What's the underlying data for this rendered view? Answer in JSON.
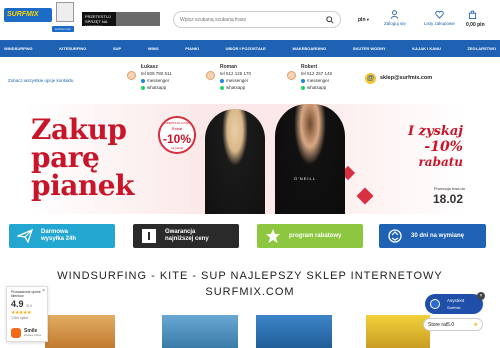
{
  "header": {
    "logo_text": "SURFMIX",
    "logo_sub": "surfmix.com",
    "promo_text": "PRZETESTUJ SPRZĘT NA MIEJSCU",
    "search_placeholder": "Wpisz szukaną szukaną frazę",
    "lang": "pln",
    "account_label": "Zaloguj się",
    "wishlist_label": "Listy zakupowe",
    "cart_total": "0,00 pln"
  },
  "nav": {
    "items": [
      "Windsurfing",
      "Kitesurfing",
      "SUP",
      "Wing",
      "Pianki",
      "Ubiór i pozostałe",
      "Wakeboarding",
      "Skuter wodny",
      "Kajak i kanu",
      "Żeglarstwo"
    ]
  },
  "contact": {
    "link": "Zobacz wszystkie opcje kontaktu",
    "people": [
      {
        "name": "Łukasz",
        "tel": "tel 509 780 511",
        "messenger": "messenger",
        "whatsapp": "whatsapp"
      },
      {
        "name": "Roman",
        "tel": "tel 512 125 170",
        "messenger": "messenger",
        "whatsapp": "whatsapp"
      },
      {
        "name": "Robert",
        "tel": "tel 512 257 145",
        "messenger": "messenger",
        "whatsapp": "whatsapp"
      }
    ],
    "email": "sklep@surfmix.com"
  },
  "hero": {
    "line1": "Zakup",
    "line2": "parę",
    "line3": "pianek",
    "badge_top": "OFERTA DLA PAR",
    "badge_mid": "Rabat",
    "badge_value": "-10%",
    "badge_bottom": "na pianki",
    "brand": "O'NEILL",
    "right1": "I zyskaj",
    "right2": "-10%",
    "right3": "rabatu",
    "until": "Promocja trwa do",
    "date": "18.02"
  },
  "features": [
    {
      "line1": "Darmowa",
      "line2": "wysyłka 24h",
      "icon": "paper-plane-icon"
    },
    {
      "line1": "Gwarancja",
      "line2": "najniższej ceny",
      "icon": "shield-icon"
    },
    {
      "line1": "program rabatowy",
      "line2": "",
      "icon": "star-icon"
    },
    {
      "line1": "30 dni na wymianę",
      "line2": "",
      "icon": "exchange-icon"
    }
  ],
  "title": {
    "line1": "WINDSURFING - KITE - SUP NAJLEPSZY SKLEP INTERNETOWY",
    "line2": "SURFMIX.COM"
  },
  "reviews": {
    "title": "Prowadzone opinie klientów",
    "score": "4.9",
    "out_of": "/5.0",
    "stars": "★★★★★",
    "count": "1284 opinii",
    "brand": "Smile",
    "brand_sub": "Zaufane Opinie"
  },
  "chat": {
    "title": "Asystent",
    "subtitle": "Surfmix",
    "close": "×",
    "store_rating": "Store rat5.0",
    "store_star": "★"
  }
}
